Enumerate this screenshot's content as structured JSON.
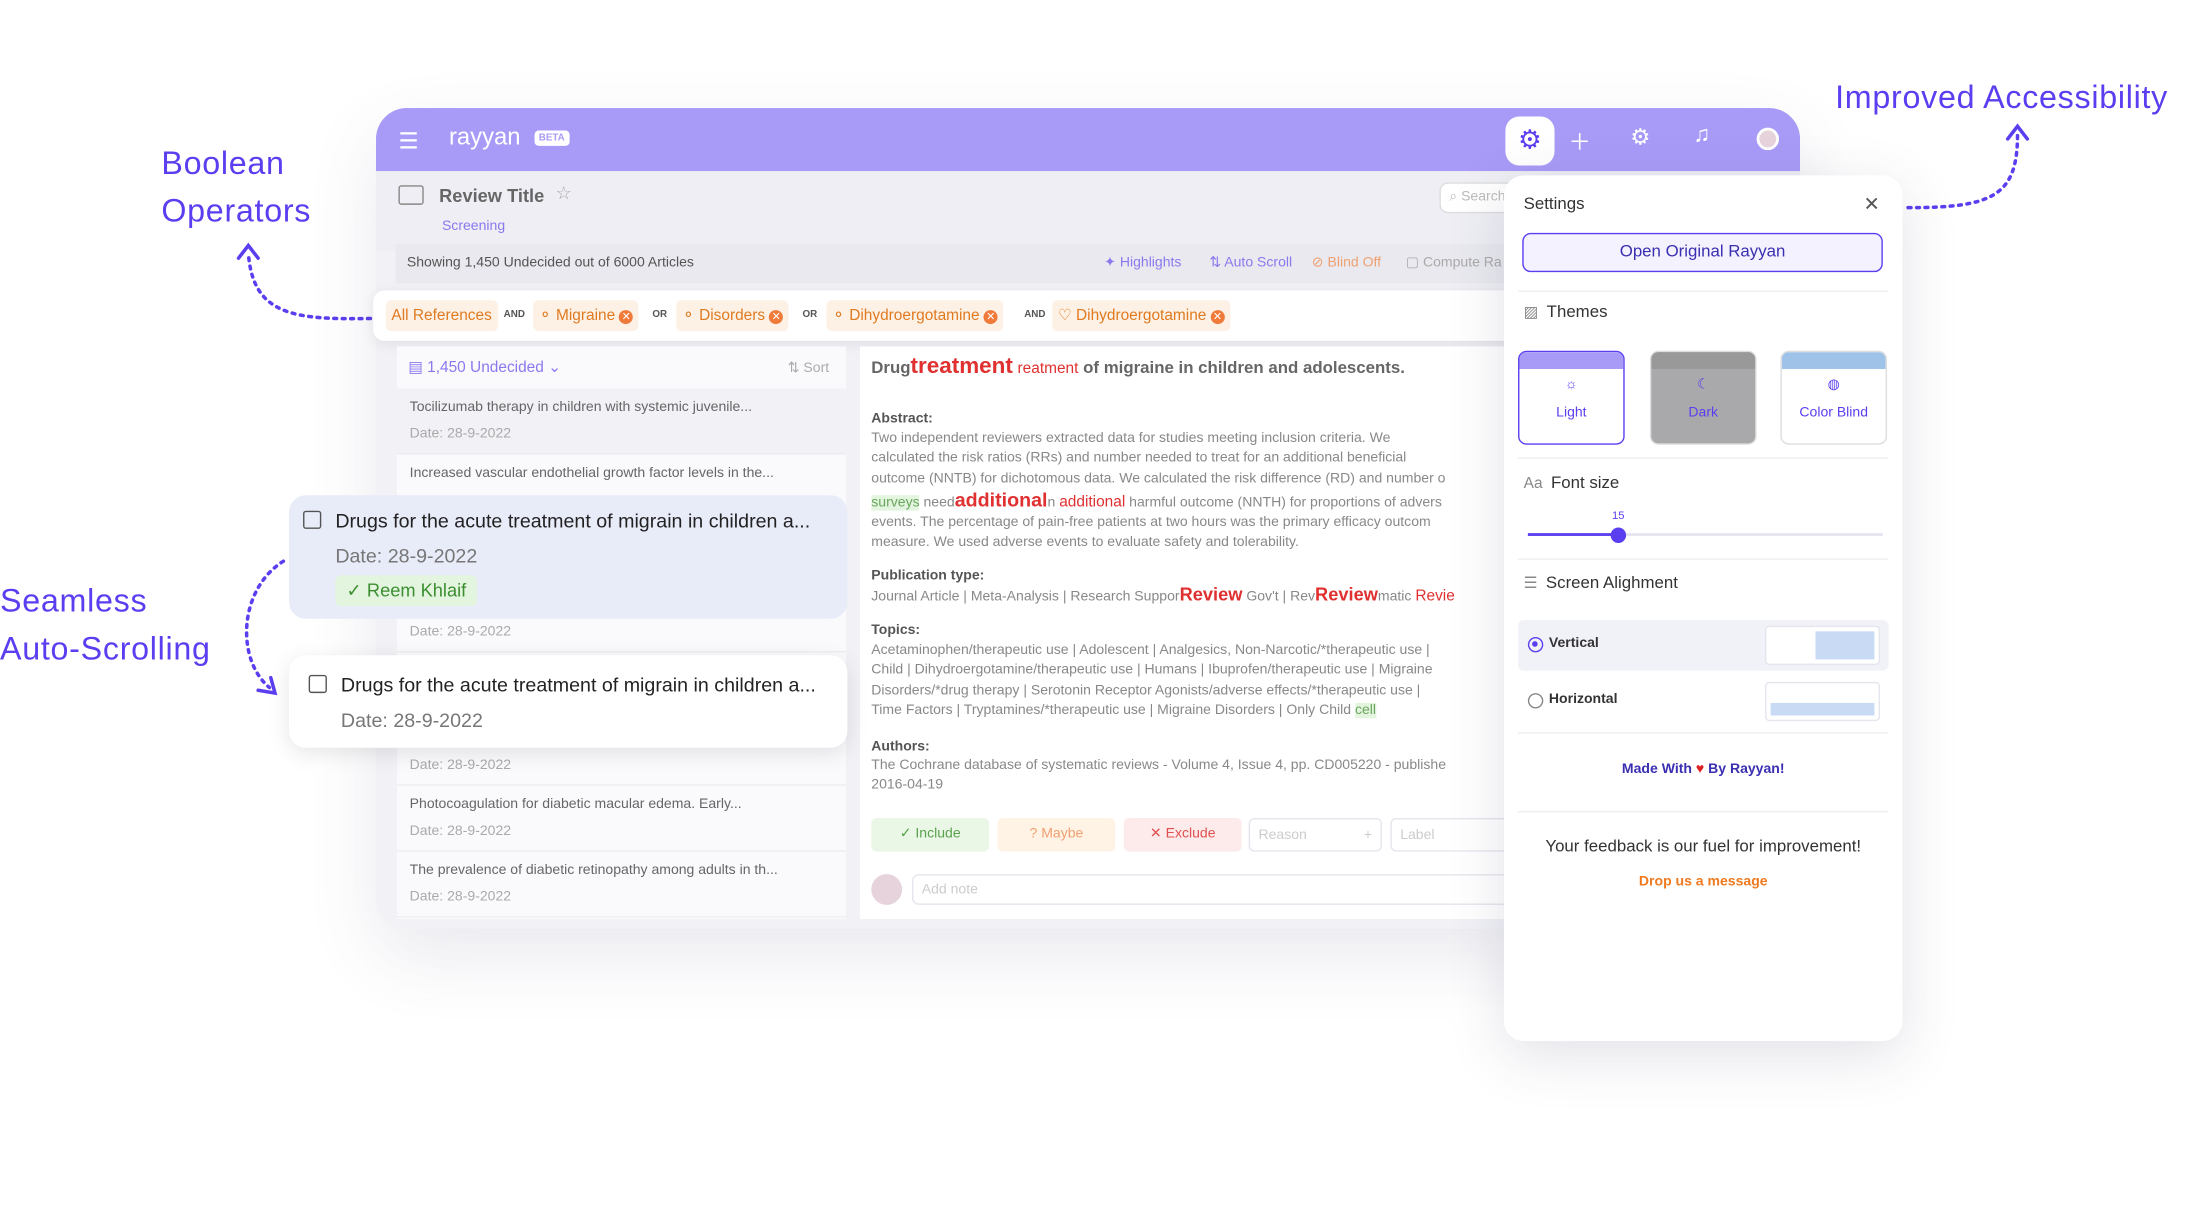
{
  "annotations": {
    "boolean": [
      "Boolean",
      "Operators"
    ],
    "accessibility": "Improved Accessibility",
    "autoscroll": [
      "Seamless",
      "Auto-Scrolling"
    ]
  },
  "topbar": {
    "brand": "rayyan",
    "beta": "BETA"
  },
  "header": {
    "title": "Review Title",
    "subtitle": "Screening",
    "search_placeholder": "Search"
  },
  "status": {
    "text": "Showing 1,450 Undecided out of 6000 Articles",
    "tools": [
      "Highlights",
      "Auto Scroll",
      "Blind Off",
      "Compute Ra"
    ]
  },
  "filters": {
    "all": "All References",
    "ops": [
      "AND",
      "OR",
      "OR",
      "AND"
    ],
    "chips": [
      "Migraine",
      "Disorders",
      "Dihydroergotamine",
      "Dihydroergotamine"
    ]
  },
  "list": {
    "header": "1,450 Undecided",
    "sort": "Sort",
    "items": [
      {
        "title": "Tocilizumab therapy in children with systemic juvenile...",
        "date": "Date: 28-9-2022"
      },
      {
        "title": "Increased vascular endothelial growth factor levels in the...",
        "date": ""
      },
      {
        "title": "",
        "date": "Date: 28-9-2022"
      },
      {
        "title": "",
        "date": "Date: 28-9-2022"
      },
      {
        "title": "Photocoagulation for diabetic macular edema. Early...",
        "date": "Date: 28-9-2022"
      },
      {
        "title": "The prevalence of diabetic retinopathy among adults in th...",
        "date": "Date: 28-9-2022"
      }
    ]
  },
  "cards": {
    "selected": {
      "title": "Drugs for the acute treatment of migrain in children a...",
      "date": "Date: 28-9-2022",
      "tag": "Reem Khlaif"
    },
    "next": {
      "title": "Drugs for the acute treatment of migrain in children a...",
      "date": "Date: 28-9-2022"
    }
  },
  "detail": {
    "title_pre": "Drug",
    "title_hl_big": "treatment",
    "title_hl_small": "reatment",
    "title_post": " of migraine in children and adolescents.",
    "abstract_label": "Abstract:",
    "abstract": [
      "Two independent reviewers extracted data for studies meeting inclusion criteria. We",
      "calculated the risk ratios (RRs) and number needed to treat for an additional beneficial",
      "outcome (NNTB) for dichotomous data. We calculated the risk difference (RD) and number o"
    ],
    "abs4": {
      "g": "surveys",
      "a": " need",
      "big": "additional",
      "b": "n ",
      "small": "additional",
      "c": " harmful outcome (NNTH) for proportions of advers"
    },
    "abstract2": [
      "events. The percentage of pain-free patients at two hours was the primary efficacy outcom",
      "measure. We used adverse events to evaluate safety and tolerability."
    ],
    "pubtype_label": "Publication type:",
    "pub": {
      "a": "Journal Article | Meta-Analysis | Research Suppor",
      "big1": "Review",
      "b": " Gov't | Rev",
      "big2": "Review",
      "c": "matic ",
      "small": "Revie"
    },
    "topics_label": "Topics:",
    "topics": [
      "Acetaminophen/therapeutic use | Adolescent | Analgesics, Non-Narcotic/*therapeutic use |",
      "Child | Dihydroergotamine/therapeutic use | Humans | Ibuprofen/therapeutic use | Migraine",
      "Disorders/*drug therapy | Serotonin Receptor Agonists/adverse effects/*therapeutic use |"
    ],
    "topics4": {
      "a": "Time Factors | Tryptamines/*therapeutic use | Migraine Disorders | Only Child ",
      "g": "cell"
    },
    "authors_label": "Authors:",
    "authors": [
      "The Cochrane database of systematic reviews - Volume 4, Issue 4, pp. CD005220 - publishe",
      "2016-04-19"
    ],
    "actions": {
      "include": "Include",
      "maybe": "Maybe",
      "exclude": "Exclude",
      "reason": "Reason",
      "label": "Label",
      "note": "Add note"
    }
  },
  "settings": {
    "title": "Settings",
    "open": "Open Original Rayyan",
    "themes": "Themes",
    "theme_options": [
      "Light",
      "Dark",
      "Color Blind"
    ],
    "fontsize_label": "Font size",
    "fontsize": 15,
    "alignment": "Screen Alighment",
    "align_options": [
      "Vertical",
      "Horizontal"
    ],
    "made": "Made With",
    "made_by": "By Rayyan!",
    "feedback": "Your feedback is our fuel for improvement!",
    "drop": "Drop us a message"
  }
}
